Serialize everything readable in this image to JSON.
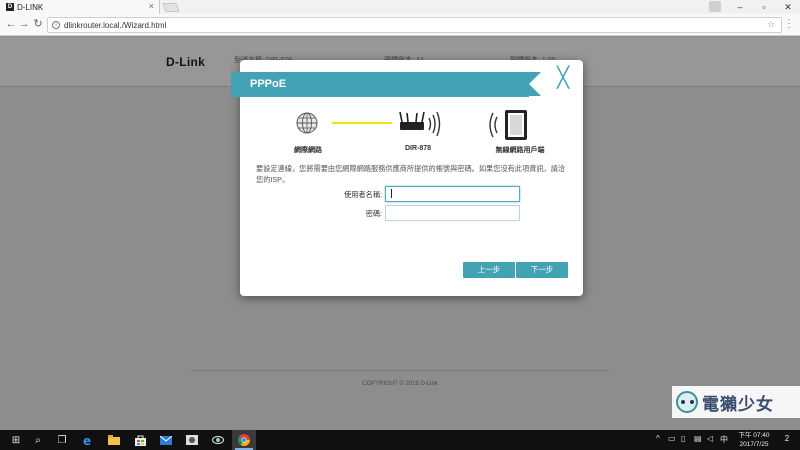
{
  "browser": {
    "tab_title": "D-LINK",
    "tab_favicon": "D",
    "tab_close": "×",
    "url": "dlinkrouter.local./Wizard.html",
    "url_info_icon": "i",
    "back": "←",
    "forward": "→",
    "reload": "↻",
    "star": "☆",
    "menu": "⋮",
    "win_min": "–",
    "win_max": "▫",
    "win_close": "✕"
  },
  "page": {
    "logo": "D-Link",
    "header": {
      "model": "型號名稱: DIR-878",
      "hw": "硬體版本: A1",
      "fw": "韌體版本: 1.00"
    },
    "copyright": "COPYRIGHT © 2016 D-Link"
  },
  "modal": {
    "title": "PPPoE",
    "close": "╳",
    "diagram": {
      "internet_label": "網際網路",
      "router_label": "DIR-878",
      "client_label": "無線網路用戶端"
    },
    "description": "要設定連線，您將需要由您網際網路服務供應商所提供的帳號與密碼。如果您沒有此項資訊，請洽您的ISP。",
    "username_label": "使用者名稱:",
    "username_value": "",
    "password_label": "密碼:",
    "password_value": "",
    "back_button": "上一步",
    "next_button": "下一步"
  },
  "watermark": {
    "text": "電獺少女"
  },
  "taskbar": {
    "start": "⊞",
    "search": "⌕",
    "taskview": "❐",
    "tray_up": "^",
    "clock_time": "下午 07:40",
    "clock_date": "2017/7/25",
    "notification_count": "2"
  },
  "colors": {
    "accent": "#43a3b5",
    "link_line": "#f2e400"
  }
}
